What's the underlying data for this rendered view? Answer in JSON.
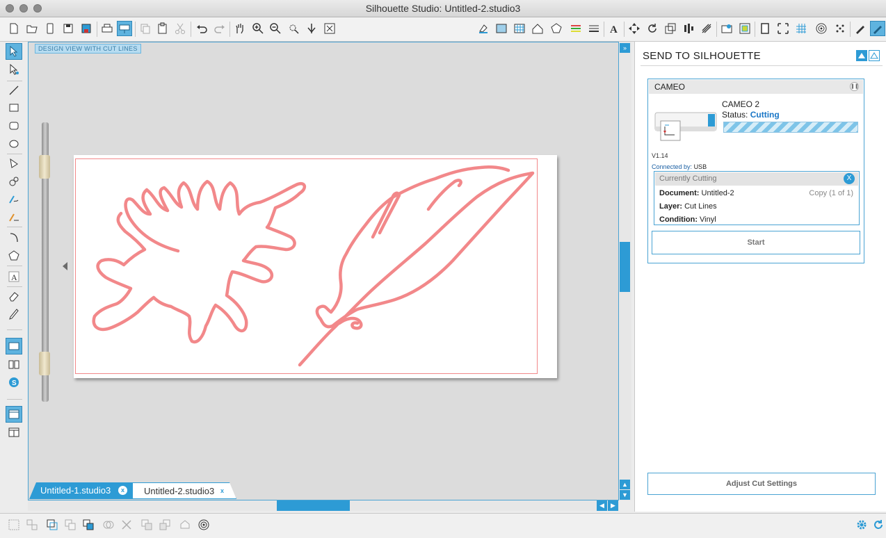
{
  "window": {
    "title": "Silhouette Studio: Untitled-2.studio3"
  },
  "canvas": {
    "view_label": "DESIGN VIEW WITH CUT LINES"
  },
  "tabs": [
    {
      "label": "Untitled-1.studio3",
      "close": "x",
      "active": false
    },
    {
      "label": "Untitled-2.studio3",
      "close": "x",
      "active": true
    }
  ],
  "panel": {
    "title": "SEND TO SILHOUETTE",
    "device_header": "CAMEO",
    "device_name": "CAMEO 2",
    "status_label": "Status:",
    "status_value": "Cutting",
    "firmware": "V1.14",
    "connected_label": "Connected by:",
    "connected_value": "USB",
    "currently_cutting": {
      "header": "Currently Cutting",
      "close": "X",
      "document_label": "Document:",
      "document_value": "Untitled-2",
      "copy": "Copy (1 of 1)",
      "layer_label": "Layer:",
      "layer_value": "Cut Lines",
      "condition_label": "Condition:",
      "condition_value": "Vinyl"
    },
    "start_button": "Start",
    "adjust_button": "Adjust Cut Settings"
  },
  "colors": {
    "accent": "#2d9bd5",
    "cut_line": "#f2888a",
    "status": "#1976c6"
  }
}
